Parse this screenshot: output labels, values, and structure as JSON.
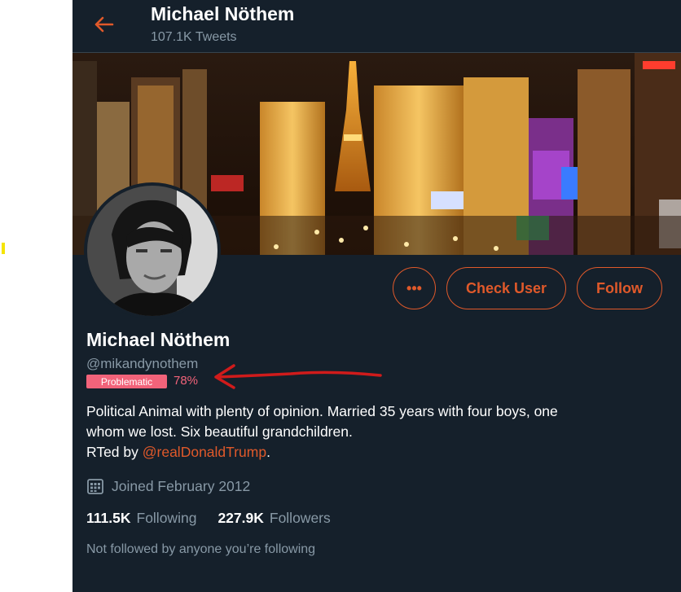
{
  "header": {
    "name": "Michael Nöthem",
    "tweet_count": "107.1K Tweets",
    "back_icon": "arrow-left-icon"
  },
  "banner": {
    "description": "night city skyline banner"
  },
  "actions": {
    "more_label": "•••",
    "check_user_label": "Check User",
    "follow_label": "Follow"
  },
  "profile": {
    "name": "Michael Nöthem",
    "handle": "@mikandynothem",
    "badge_label": "Problematic",
    "badge_percent": "78%",
    "bio_line1": "Political Animal with plenty of opinion. Married 35 years with four boys, one",
    "bio_line2": "whom we lost. Six beautiful grandchildren.",
    "bio_rt_prefix": "RTed by ",
    "bio_rt_link": "@realDonaldTrump",
    "bio_rt_suffix": ".",
    "joined": "Joined February 2012",
    "following_count": "111.5K",
    "following_label": "Following",
    "followers_count": "227.9K",
    "followers_label": "Followers",
    "not_followed": "Not followed by anyone you’re following"
  },
  "colors": {
    "background": "#15202b",
    "accent": "#e0592a",
    "muted": "#8899a6",
    "badge": "#f2637a",
    "annotation_arrow": "#d01b1b"
  }
}
